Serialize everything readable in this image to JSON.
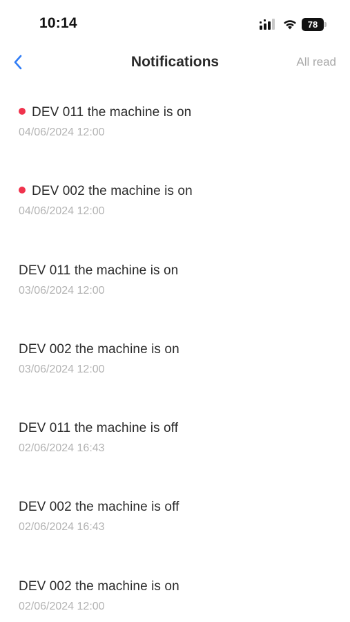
{
  "status_bar": {
    "time": "10:14",
    "battery": "78",
    "icons": [
      "signal-icon",
      "wifi-icon",
      "battery-icon"
    ]
  },
  "nav": {
    "back_icon": "chevron-left-icon",
    "title": "Notifications",
    "all_read_label": "All read"
  },
  "colors": {
    "accent": "#2f7cf6",
    "unread_dot": "#f0334d",
    "muted_text": "#b3b3b3"
  },
  "notifications": [
    {
      "title": "DEV 011 the machine is on",
      "time": "04/06/2024 12:00",
      "unread": true
    },
    {
      "title": "DEV 002 the machine is on",
      "time": "04/06/2024 12:00",
      "unread": true
    },
    {
      "title": "DEV 011 the machine is on",
      "time": "03/06/2024 12:00",
      "unread": false
    },
    {
      "title": "DEV 002 the machine is on",
      "time": "03/06/2024 12:00",
      "unread": false
    },
    {
      "title": "DEV 011 the machine is off",
      "time": "02/06/2024 16:43",
      "unread": false
    },
    {
      "title": "DEV 002 the machine is off",
      "time": "02/06/2024 16:43",
      "unread": false
    },
    {
      "title": "DEV 002 the machine is on",
      "time": "02/06/2024 12:00",
      "unread": false
    }
  ]
}
